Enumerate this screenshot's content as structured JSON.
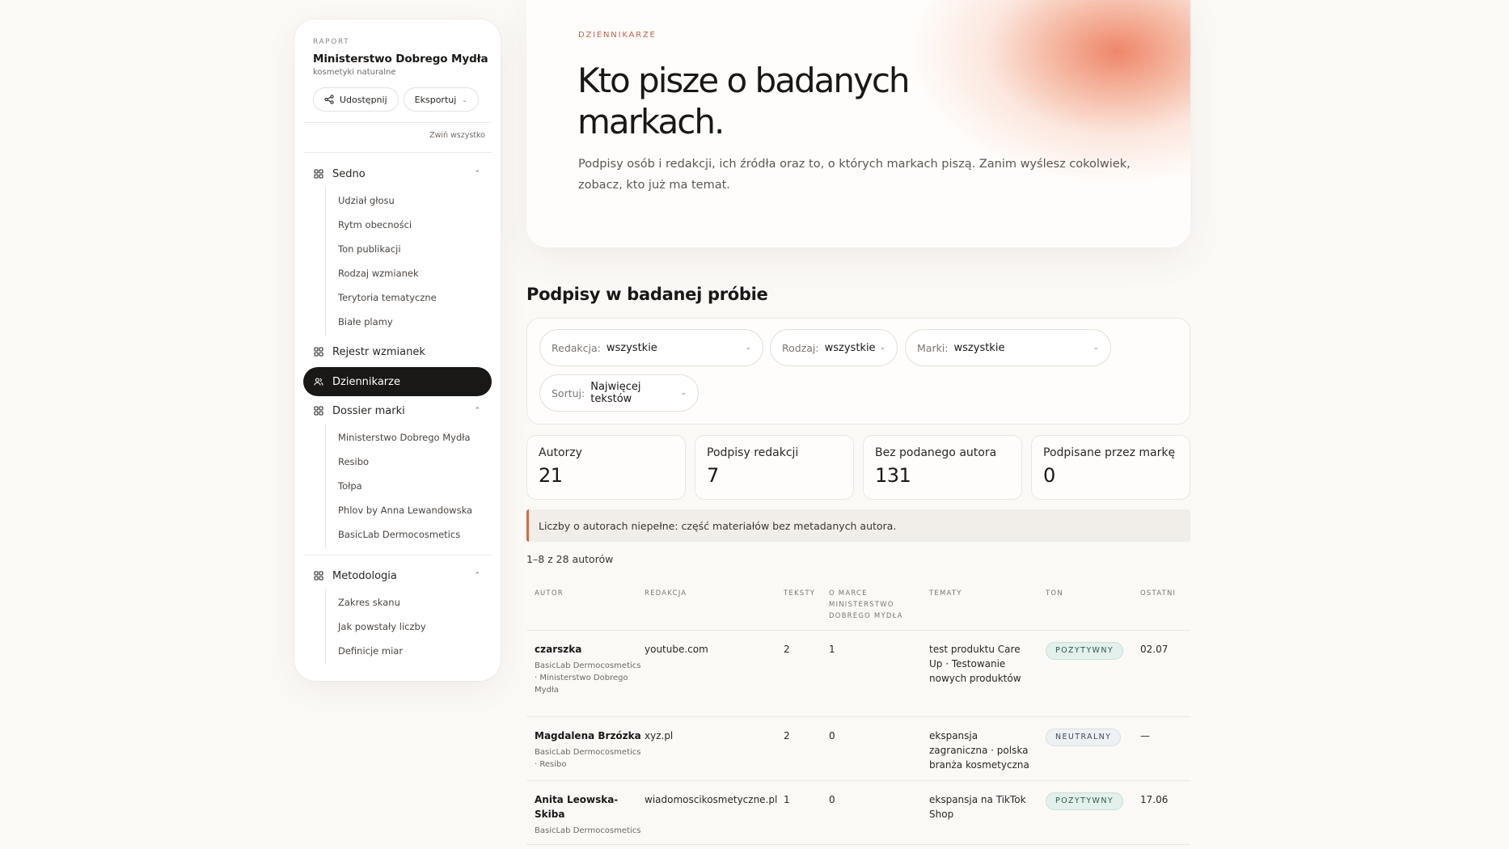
{
  "sidebar": {
    "eyebrow": "RAPORT",
    "title": "Ministerstwo Dobrego Mydła",
    "subtitle": "kosmetyki naturalne",
    "share_label": "Udostępnij",
    "export_label": "Eksportuj",
    "collapse_all": "Zwiń wszystko",
    "groups": [
      {
        "label": "Sedno",
        "items": [
          "Udział głosu",
          "Rytm obecności",
          "Ton publikacji",
          "Rodzaj wzmianek",
          "Terytoria tematyczne",
          "Białe plamy"
        ]
      },
      {
        "label": "Rejestr wzmianek"
      },
      {
        "label": "Dziennikarze",
        "active": true
      },
      {
        "label": "Dossier marki",
        "items": [
          "Ministerstwo Dobrego Mydła",
          "Resibo",
          "Tołpa",
          "Phlov by Anna Lewandowska",
          "BasicLab Dermocosmetics"
        ]
      },
      {
        "label": "Metodologia",
        "items": [
          "Zakres skanu",
          "Jak powstały liczby",
          "Definicje miar"
        ]
      }
    ]
  },
  "hero": {
    "eyebrow": "DZIENNIKARZE",
    "title": "Kto pisze o badanych markach.",
    "lead": "Podpisy osób i redakcji, ich źródła oraz to, o których markach piszą. Zanim wyślesz cokolwiek, zobacz, kto już ma temat."
  },
  "section": {
    "title": "Podpisy w badanej próbie",
    "filters": {
      "redakcja": {
        "label": "Redakcja:",
        "value": "wszystkie"
      },
      "rodzaj": {
        "label": "Rodzaj:",
        "value": "wszystkie"
      },
      "marki": {
        "label": "Marki:",
        "value": "wszystkie"
      },
      "sortuj": {
        "label": "Sortuj:",
        "value": "Najwięcej tekstów"
      }
    },
    "stats": [
      {
        "label": "Autorzy",
        "value": "21"
      },
      {
        "label": "Podpisy redakcji",
        "value": "7"
      },
      {
        "label": "Bez podanego autora",
        "value": "131"
      },
      {
        "label": "Podpisane przez markę",
        "value": "0"
      }
    ],
    "notice": "Liczby o autorach niepełne: część materiałów bez metadanych autora.",
    "count": "1–8 z 28 autorów"
  },
  "table": {
    "headers": {
      "autor": "AUTOR",
      "redakcja": "REDAKCJA",
      "teksty": "TEKSTY",
      "o_marce": "O MARCE MINISTERSTWO DOBREGO MYDŁA",
      "tematy": "TEMATY",
      "ton": "TON",
      "ostatni": "OSTATNI"
    },
    "rows": [
      {
        "author": "czarszka",
        "brands": "BasicLab Dermocosmetics · Ministerstwo Dobrego Mydła",
        "outlet": "youtube.com",
        "texts": "2",
        "about": "1",
        "topics": "test produktu Care Up · Testowanie nowych produktów",
        "tone": "POZYTYWNY",
        "last": "02.07"
      },
      {
        "author": "Magdalena Brzózka",
        "brands": "BasicLab Dermocosmetics · Resibo",
        "outlet": "xyz.pl",
        "texts": "2",
        "about": "0",
        "topics": "ekspansja zagraniczna · polska branża kosmetyczna",
        "tone": "NEUTRALNY",
        "last": "—"
      },
      {
        "author": "Anita Leowska-Skiba",
        "brands": "BasicLab Dermocosmetics",
        "outlet": "wiadomoscikosmetyczne.pl",
        "texts": "1",
        "about": "0",
        "topics": "ekspansja na TikTok Shop",
        "tone": "POZYTYWNY",
        "last": "17.06"
      }
    ]
  },
  "colors": {
    "accent": "#c8614a",
    "dark": "#1a1816",
    "positive": "#e3f0ec",
    "neutral": "#eef1f4"
  }
}
